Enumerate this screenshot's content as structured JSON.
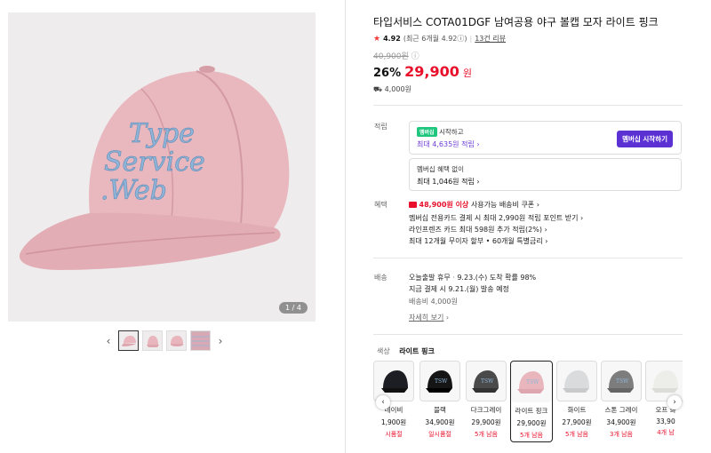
{
  "gallery": {
    "page_indicator": "1 / 4",
    "prev_icon": "chevron-left-icon",
    "next_icon": "chevron-right-icon",
    "hat_color": "#e8b6bc",
    "logo_lines": [
      "Type",
      "Service",
      ".Web"
    ]
  },
  "product": {
    "title": "타입서비스 COTA01DGF 남여공용 야구 볼캡 모자 라이트 핑크",
    "rating": "4.92",
    "rating_detail": "(최근 6개월 4.92",
    "review_link": "13건 리뷰",
    "original_price": "40,900원",
    "discount": "26%",
    "price": "29,900",
    "price_unit": "원",
    "shipping_fee_small": "4,000원"
  },
  "points": {
    "label": "적립",
    "membership_tag": "멤버십",
    "membership_start": "시작하고",
    "membership_max": "최대 4,635원 적립",
    "membership_button": "멤버십 시작하기",
    "no_membership": "멤버십 혜택 없이",
    "no_membership_max": "최대 1,046원 적립"
  },
  "benefits": {
    "label": "혜택",
    "coupon_amount": "48,900원 이상",
    "coupon_text": "사용가능 배송비 쿠폰",
    "card": "멤버십 전용카드 결제 시 최대 2,990원 적립 포인트 받기",
    "friends": "라인프렌즈 카드 최대 598원 추가 적립(2%)",
    "installment": "최대 12개월 무이자 할부 • 60개월 특별금리"
  },
  "delivery": {
    "label": "배송",
    "today": "오늘출발 휴무",
    "arrival": "9.23.(수) 도착 확률 98%",
    "order_now": "지금 결제 시 9.21.(월) 발송 예정",
    "fee": "배송비 4,000원",
    "details_link": "자세히 보기"
  },
  "colors": {
    "label": "색상",
    "selected": "라이트 핑크",
    "items": [
      {
        "name": "네이비",
        "price": "1,900원",
        "stock": "시품절",
        "hex": "#1d1d24"
      },
      {
        "name": "블랙",
        "price": "34,900원",
        "stock": "일시품절",
        "hex": "#151515"
      },
      {
        "name": "다크그레이",
        "price": "29,900원",
        "stock": "5개 남음",
        "hex": "#4a4a4a"
      },
      {
        "name": "라이트 핑크",
        "price": "29,900원",
        "stock": "5개 남음",
        "hex": "#e8b6bc"
      },
      {
        "name": "화이트",
        "price": "27,900원",
        "stock": "5개 남음",
        "hex": "#d9dbdd"
      },
      {
        "name": "스톤 그레이",
        "price": "34,900원",
        "stock": "3개 남음",
        "hex": "#7d7d7d"
      },
      {
        "name": "오프 화",
        "price": "33,90",
        "stock": "4개 남",
        "hex": "#ededea"
      }
    ]
  }
}
